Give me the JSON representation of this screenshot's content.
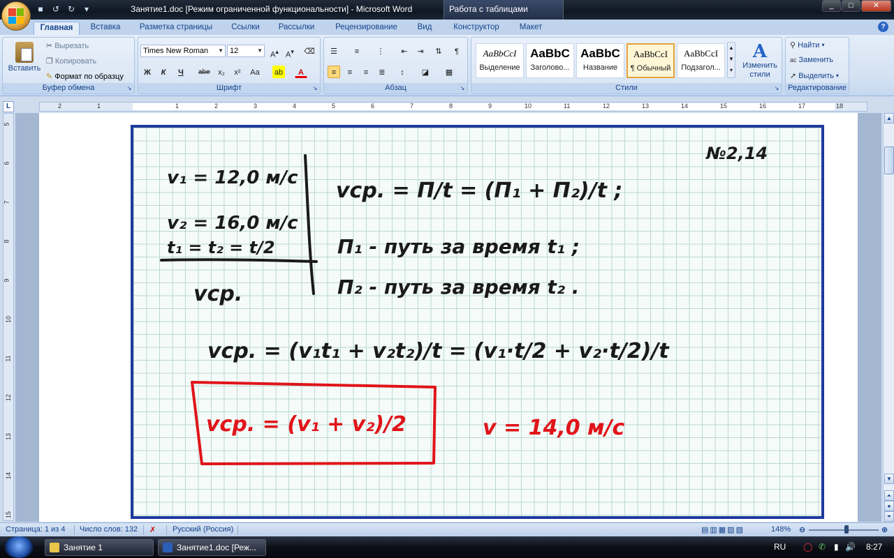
{
  "window": {
    "title": "Занятие1.doc [Режим ограниченной функциональности] - Microsoft Word",
    "contextual_tab_group": "Работа с таблицами",
    "controls": {
      "minimize": "_",
      "maximize": "□",
      "close": "✕"
    }
  },
  "tabs": [
    "Главная",
    "Вставка",
    "Разметка страницы",
    "Ссылки",
    "Рассылки",
    "Рецензирование",
    "Вид",
    "Конструктор",
    "Макет"
  ],
  "ribbon": {
    "clipboard": {
      "paste": "Вставить",
      "cut": "Вырезать",
      "copy": "Копировать",
      "format_painter": "Формат по образцу",
      "label": "Буфер обмена"
    },
    "font": {
      "family": "Times New Roman",
      "size": "12",
      "label": "Шрифт",
      "buttons": [
        "Ж",
        "К",
        "Ч",
        "abe",
        "x₂",
        "x²",
        "Aa"
      ]
    },
    "paragraph": {
      "label": "Абзац"
    },
    "styles": {
      "label": "Стили",
      "items": [
        {
          "sample": "AaBbCcI",
          "name": "Выделение"
        },
        {
          "sample": "AaBbC",
          "name": "Заголово..."
        },
        {
          "sample": "AaBbC",
          "name": "Название"
        },
        {
          "sample": "AaBbCcI",
          "name": "¶ Обычный"
        },
        {
          "sample": "AaBbCcI",
          "name": "Подзагол..."
        }
      ],
      "change_styles": "Изменить стили"
    },
    "editing": {
      "label": "Редактирование",
      "find": "Найти",
      "replace": "Заменить",
      "select": "Выделить"
    }
  },
  "ruler": {
    "h_numbers": [
      "2",
      "1",
      "1",
      "2",
      "3",
      "4",
      "5",
      "6",
      "7",
      "8",
      "9",
      "10",
      "11",
      "12",
      "13",
      "14",
      "15",
      "16",
      "17",
      "18"
    ],
    "v_numbers": [
      "5",
      "6",
      "7",
      "8",
      "9",
      "10",
      "11",
      "12",
      "13",
      "14",
      "15"
    ]
  },
  "document": {
    "problem_number": "№2,14",
    "given": {
      "v1": "v₁ = 12,0 м/с",
      "v2": "v₂ = 16,0 м/с",
      "t": "t₁ = t₂ = t/2",
      "find": "vср."
    },
    "formulas": {
      "f1": "vср. = П/t = (П₁ + П₂)/t ;",
      "def1": "П₁ - путь за время t₁ ;",
      "def2": "П₂ - путь за время t₂ .",
      "f2": "vср. = (v₁t₁ + v₂t₂)/t = (v₁·t/2 + v₂·t/2)/t",
      "answer_box": "vср. = (v₁ + v₂)/2",
      "answer": "v = 14,0 м/с"
    }
  },
  "statusbar": {
    "page": "Страница: 1 из 4",
    "words": "Число слов: 132",
    "language": "Русский (Россия)",
    "zoom": "148%"
  },
  "taskbar": {
    "items": [
      "Занятие 1",
      "Занятие1.doc [Реж..."
    ],
    "lang": "RU",
    "time": "8:27"
  }
}
